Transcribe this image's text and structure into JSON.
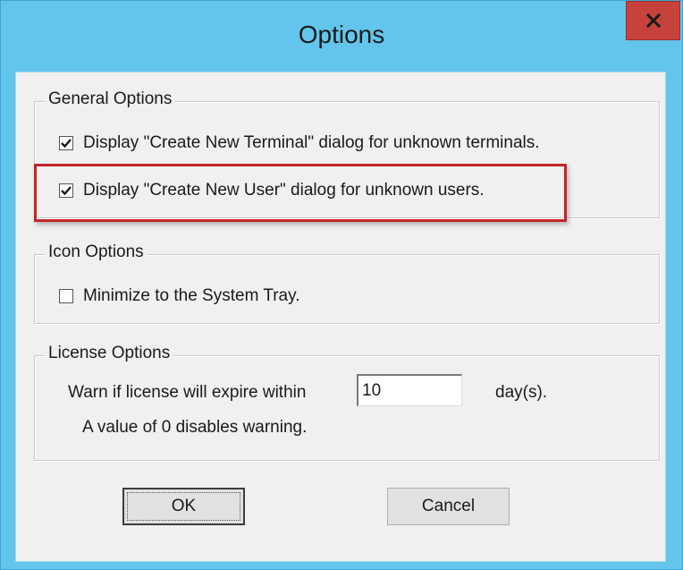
{
  "window": {
    "title": "Options",
    "close_glyph": "close-icon"
  },
  "general": {
    "label": "General Options",
    "options": [
      {
        "label": "Display \"Create New Terminal\" dialog for unknown terminals.",
        "checked": true
      },
      {
        "label": "Display \"Create New User\" dialog for unknown users.",
        "checked": true
      }
    ]
  },
  "icon_options": {
    "label": "Icon Options",
    "minimize": {
      "label": "Minimize to the System Tray.",
      "checked": false
    }
  },
  "license": {
    "label": "License Options",
    "warn_text": "Warn if license will expire within",
    "days_value": "10",
    "days_unit": "day(s).",
    "note": "A value of 0 disables warning."
  },
  "buttons": {
    "ok": "OK",
    "cancel": "Cancel"
  },
  "colors": {
    "titlebar": "#63c5eb",
    "close_button": "#c8423d",
    "highlight_box": "#c2262b"
  }
}
